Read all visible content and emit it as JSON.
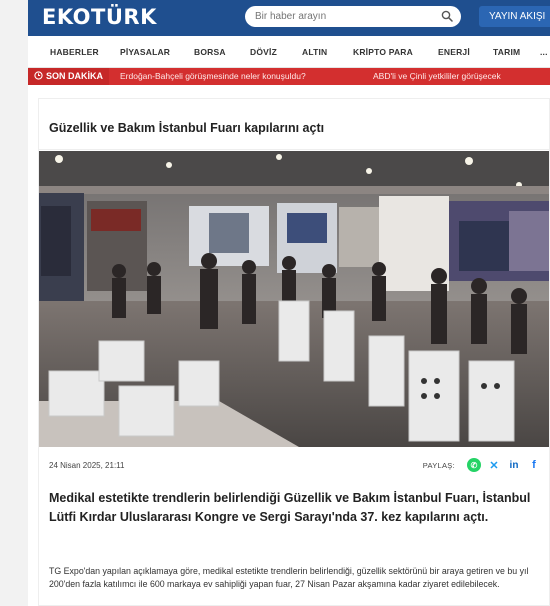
{
  "brand": {
    "logo": "EKOTÜRK"
  },
  "search": {
    "placeholder": "Bir haber arayın"
  },
  "header": {
    "live_label": "YAYIN AKIŞI"
  },
  "nav": {
    "items": [
      "HABERLER",
      "PİYASALAR",
      "BORSA",
      "DÖVİZ",
      "ALTIN",
      "KRİPTO PARA",
      "ENERJİ",
      "TARIM",
      "..."
    ]
  },
  "breaking": {
    "label": "SON DAKİKA",
    "items": [
      "Erdoğan-Bahçeli görüşmesinde neler konuşuldu?",
      "ABD'li ve Çinli yetkililer görüşecek"
    ]
  },
  "article": {
    "title": "Güzellik ve Bakım İstanbul Fuarı kapılarını açtı",
    "date": "24 Nisan 2025, 21:11",
    "share_label": "PAYLAŞ:",
    "share_icons": [
      "whatsapp-icon",
      "x-icon",
      "linkedin-icon",
      "facebook-icon"
    ],
    "lead": "Medikal estetikte trendlerin belirlendiği Güzellik ve Bakım İstanbul Fuarı, İstanbul Lütfi Kırdar Uluslararası Kongre ve Sergi Sarayı'nda 37. kez kapılarını açtı.",
    "body": "TG Expo'dan yapılan açıklamaya göre, medikal estetikte trendlerin belirlendiği, güzellik sektörünü bir araya getiren ve bu yıl 200'den fazla katılımcı ile 600 markaya ev sahipliği yapan fuar, 27 Nisan Pazar akşamına kadar ziyaret edilebilecek."
  },
  "colors": {
    "header_bg": "#1f4f8f",
    "breaking_bg": "#d32f2f",
    "accent": "#2b66b3"
  }
}
